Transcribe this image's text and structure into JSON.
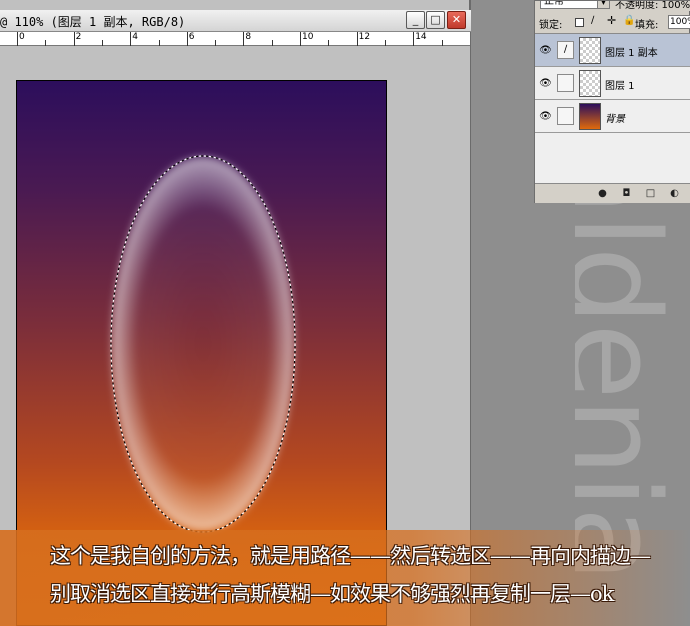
{
  "document": {
    "title": "@ 110% (图层 1 副本, RGB/8)",
    "window_buttons": {
      "minimize": "_",
      "maximize": "□",
      "close": "✕"
    },
    "ruler_labels": [
      "0",
      "2",
      "4",
      "6",
      "8",
      "10",
      "12",
      "14"
    ]
  },
  "layers_panel": {
    "blend_mode": "正常",
    "opacity_label": "不透明度: 100%",
    "lock_label": "锁定:",
    "fill_label": "填充:",
    "fill_value": "100%",
    "layers": [
      {
        "name": "图层 1 副本",
        "selected": true,
        "visible": true,
        "type": "transparent"
      },
      {
        "name": "图层 1",
        "selected": false,
        "visible": true,
        "type": "transparent"
      },
      {
        "name": "背景",
        "selected": false,
        "visible": true,
        "type": "background"
      }
    ],
    "icons": [
      "eye-icon",
      "brush-icon",
      "link-icon",
      "new-layer-icon",
      "trash-icon"
    ]
  },
  "watermark": "aldenia",
  "caption": {
    "line1": "这个是我自创的方法，就是用路径——然后转选区——再向内描边—",
    "line2": "别取消选区直接进行高斯模糊—如效果不够强烈再复制一层—ok"
  },
  "colors": {
    "gradient_top": "#2c0e5c",
    "gradient_bottom": "#ec7a0a",
    "caption_band": "#d66e1e"
  }
}
